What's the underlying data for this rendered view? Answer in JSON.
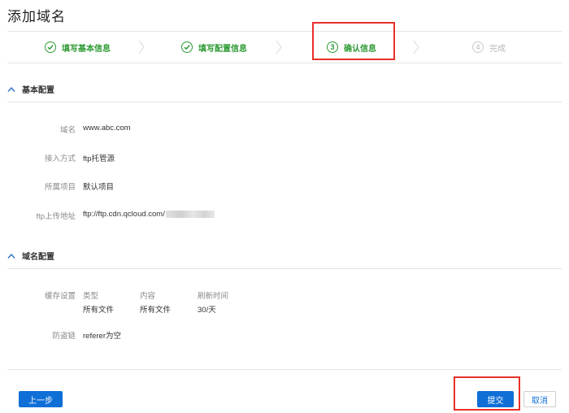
{
  "page": {
    "title": "添加域名"
  },
  "steps": [
    {
      "index": "1",
      "label": "填写基本信息",
      "status": "done"
    },
    {
      "index": "2",
      "label": "填写配置信息",
      "status": "done"
    },
    {
      "index": "3",
      "label": "确认信息",
      "status": "current"
    },
    {
      "index": "4",
      "label": "完成",
      "status": "pending"
    }
  ],
  "basic_section": {
    "title": "基本配置",
    "fields": [
      {
        "label": "域名",
        "value": "www.abc.com"
      },
      {
        "label": "接入方式",
        "value": "ftp托管源"
      },
      {
        "label": "所属项目",
        "value": "默认项目"
      },
      {
        "label": "ftp上传地址",
        "value": "ftp://ftp.cdn.qcloud.com/"
      }
    ]
  },
  "domain_section": {
    "title": "域名配置",
    "cache": {
      "label": "缓存设置",
      "headers": [
        "类型",
        "内容",
        "刷新时间"
      ],
      "row": [
        "所有文件",
        "所有文件",
        "30/天"
      ]
    },
    "hotlink": {
      "label": "防盗链",
      "value": "referer为空"
    }
  },
  "buttons": {
    "prev": "上一步",
    "submit": "提交",
    "cancel": "取消"
  },
  "colors": {
    "accent": "#0f6fd6",
    "success": "#2e9b34",
    "highlight": "#e8302a"
  }
}
